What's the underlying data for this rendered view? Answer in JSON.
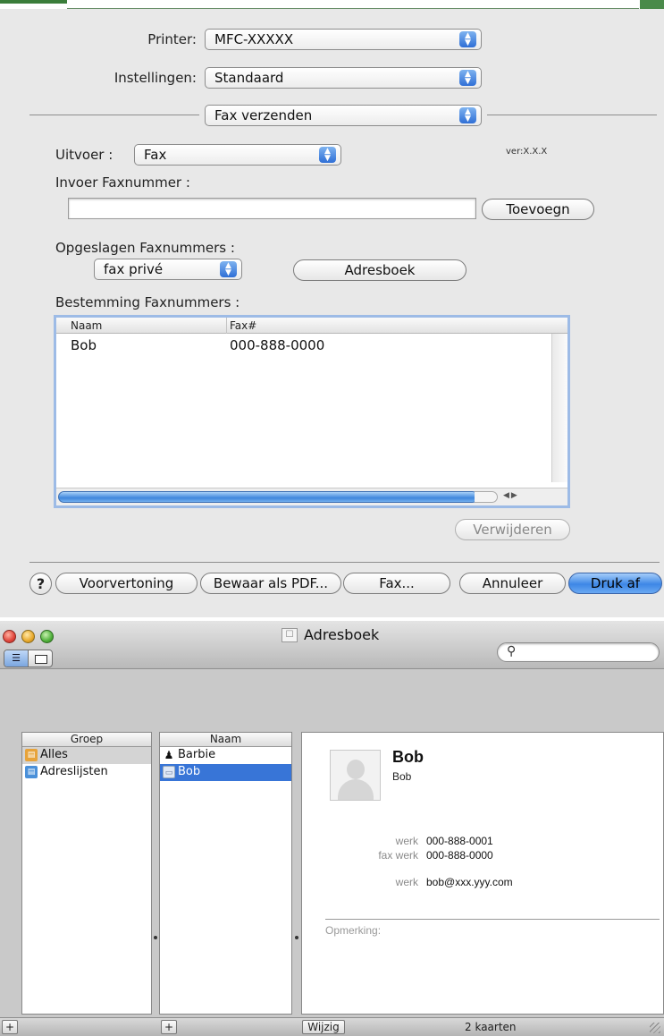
{
  "print_dialog": {
    "printer_label": "Printer:",
    "printer_value": "MFC-XXXXX",
    "settings_label": "Instellingen:",
    "settings_value": "Standaard",
    "panel_value": "Fax verzenden",
    "output_label": "Uitvoer :",
    "output_value": "Fax",
    "version": "ver:X.X.X",
    "input_fax_label": "Invoer Faxnummer :",
    "input_fax_value": "",
    "add_button": "Toevoegn",
    "saved_numbers_label": "Opgeslagen Faxnummers :",
    "saved_numbers_value": "fax privé",
    "address_book_button": "Adresboek",
    "destination_label": "Bestemming Faxnummers :",
    "table": {
      "columns": [
        "Naam",
        "Fax#"
      ],
      "rows": [
        {
          "name": "Bob",
          "fax": "000-888-0000"
        }
      ]
    },
    "delete_button": "Verwijderen",
    "help_button": "?",
    "preview_button": "Voorvertoning",
    "save_pdf_button": "Bewaar als PDF...",
    "fax_button": "Fax...",
    "cancel_button": "Annuleer",
    "print_button": "Druk af"
  },
  "address_book": {
    "title": "Adresboek",
    "search_placeholder": "",
    "groups_header": "Groep",
    "groups": [
      {
        "label": "Alles",
        "selected": true
      },
      {
        "label": "Adreslijsten",
        "selected": false
      }
    ],
    "names_header": "Naam",
    "names": [
      {
        "label": "Barbie",
        "selected": false
      },
      {
        "label": "Bob",
        "selected": true
      }
    ],
    "card": {
      "name": "Bob",
      "subtitle": "Bob",
      "fields": [
        {
          "key": "werk",
          "value": "000-888-0001"
        },
        {
          "key": "fax werk",
          "value": "000-888-0000"
        },
        {
          "key": "werk",
          "value": "bob@xxx.yyy.com"
        }
      ],
      "note_label": "Opmerking:"
    },
    "add_group_button": "+",
    "add_person_button": "+",
    "edit_button": "Wijzig",
    "card_count": "2 kaarten"
  },
  "colors": {
    "accent_blue": "#3d87e6",
    "selection_blue": "#3875d7",
    "dialog_bg": "#e8e8e8"
  }
}
